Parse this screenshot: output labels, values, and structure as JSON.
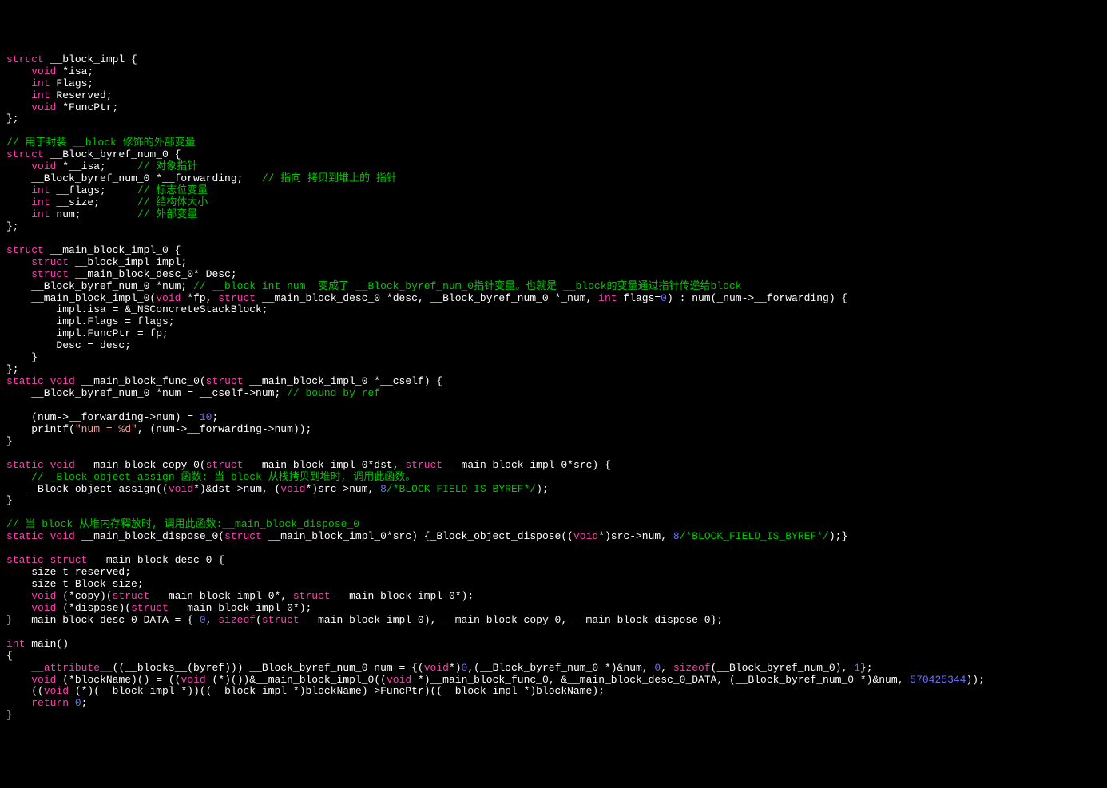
{
  "code": {
    "lines": [
      [
        [
          "kw",
          "struct"
        ],
        [
          "id",
          " __block_impl {"
        ]
      ],
      [
        [
          "id",
          "    "
        ],
        [
          "kw",
          "void"
        ],
        [
          "id",
          " *isa;"
        ]
      ],
      [
        [
          "id",
          "    "
        ],
        [
          "kw",
          "int"
        ],
        [
          "id",
          " Flags;"
        ]
      ],
      [
        [
          "id",
          "    "
        ],
        [
          "kw",
          "int"
        ],
        [
          "id",
          " Reserved;"
        ]
      ],
      [
        [
          "id",
          "    "
        ],
        [
          "kw",
          "void"
        ],
        [
          "id",
          " *FuncPtr;"
        ]
      ],
      [
        [
          "id",
          "};"
        ]
      ],
      [],
      [
        [
          "cm",
          "// 用于封装 __block 修饰的外部变量"
        ]
      ],
      [
        [
          "kw",
          "struct"
        ],
        [
          "id",
          " __Block_byref_num_0 {"
        ]
      ],
      [
        [
          "id",
          "    "
        ],
        [
          "kw",
          "void"
        ],
        [
          "id",
          " *__isa;     "
        ],
        [
          "cm",
          "// 对象指针"
        ]
      ],
      [
        [
          "id",
          "    __Block_byref_num_0 *__forwarding;   "
        ],
        [
          "cm",
          "// 指向 拷贝到堆上的 指针"
        ]
      ],
      [
        [
          "id",
          "    "
        ],
        [
          "kw",
          "int"
        ],
        [
          "id",
          " __flags;     "
        ],
        [
          "cm",
          "// 标志位变量"
        ]
      ],
      [
        [
          "id",
          "    "
        ],
        [
          "kw",
          "int"
        ],
        [
          "id",
          " __size;      "
        ],
        [
          "cm",
          "// 结构体大小"
        ]
      ],
      [
        [
          "id",
          "    "
        ],
        [
          "kw",
          "int"
        ],
        [
          "id",
          " num;         "
        ],
        [
          "cm",
          "// 外部变量"
        ]
      ],
      [
        [
          "id",
          "};"
        ]
      ],
      [],
      [
        [
          "kw",
          "struct"
        ],
        [
          "id",
          " __main_block_impl_0 {"
        ]
      ],
      [
        [
          "id",
          "    "
        ],
        [
          "kw",
          "struct"
        ],
        [
          "id",
          " __block_impl impl;"
        ]
      ],
      [
        [
          "id",
          "    "
        ],
        [
          "kw",
          "struct"
        ],
        [
          "id",
          " __main_block_desc_0* Desc;"
        ]
      ],
      [
        [
          "id",
          "    __Block_byref_num_0 *num; "
        ],
        [
          "cm",
          "// __block int num  变成了 __Block_byref_num_0指针变量。也就是 __block的变量通过指针传递给block"
        ]
      ],
      [
        [
          "id",
          "    __main_block_impl_0("
        ],
        [
          "kw",
          "void"
        ],
        [
          "id",
          " *fp, "
        ],
        [
          "kw",
          "struct"
        ],
        [
          "id",
          " __main_block_desc_0 *desc, __Block_byref_num_0 *_num, "
        ],
        [
          "kw",
          "int"
        ],
        [
          "id",
          " flags="
        ],
        [
          "num",
          "0"
        ],
        [
          "id",
          ") : num(_num->__forwarding) {"
        ]
      ],
      [
        [
          "id",
          "        impl.isa = &_NSConcreteStackBlock;"
        ]
      ],
      [
        [
          "id",
          "        impl.Flags = flags;"
        ]
      ],
      [
        [
          "id",
          "        impl.FuncPtr = fp;"
        ]
      ],
      [
        [
          "id",
          "        Desc = desc;"
        ]
      ],
      [
        [
          "id",
          "    }"
        ]
      ],
      [
        [
          "id",
          "};"
        ]
      ],
      [
        [
          "kw",
          "static"
        ],
        [
          "id",
          " "
        ],
        [
          "kw",
          "void"
        ],
        [
          "id",
          " __main_block_func_0("
        ],
        [
          "kw",
          "struct"
        ],
        [
          "id",
          " __main_block_impl_0 *__cself) {"
        ]
      ],
      [
        [
          "id",
          "    __Block_byref_num_0 *num = __cself->num; "
        ],
        [
          "cm",
          "// bound by ref"
        ]
      ],
      [],
      [
        [
          "id",
          "    (num->__forwarding->num) = "
        ],
        [
          "num",
          "10"
        ],
        [
          "id",
          ";"
        ]
      ],
      [
        [
          "id",
          "    printf("
        ],
        [
          "str",
          "\"num = %d\""
        ],
        [
          "id",
          ", (num->__forwarding->num));"
        ]
      ],
      [
        [
          "id",
          "}"
        ]
      ],
      [],
      [
        [
          "kw",
          "static"
        ],
        [
          "id",
          " "
        ],
        [
          "kw",
          "void"
        ],
        [
          "id",
          " __main_block_copy_0("
        ],
        [
          "kw",
          "struct"
        ],
        [
          "id",
          " __main_block_impl_0*dst, "
        ],
        [
          "kw",
          "struct"
        ],
        [
          "id",
          " __main_block_impl_0*src) {"
        ]
      ],
      [
        [
          "id",
          "    "
        ],
        [
          "cm",
          "// _Block_object_assign 函数: 当 block 从栈拷贝到堆时, 调用此函数。"
        ]
      ],
      [
        [
          "id",
          "    _Block_object_assign(("
        ],
        [
          "kw",
          "void"
        ],
        [
          "id",
          "*)&dst->num, ("
        ],
        [
          "kw",
          "void"
        ],
        [
          "id",
          "*)src->num, "
        ],
        [
          "num",
          "8"
        ],
        [
          "cm",
          "/*BLOCK_FIELD_IS_BYREF*/"
        ],
        [
          "id",
          ");"
        ]
      ],
      [
        [
          "id",
          "}"
        ]
      ],
      [],
      [
        [
          "cm",
          "// 当 block 从堆内存释放时, 调用此函数:__main_block_dispose_0"
        ]
      ],
      [
        [
          "kw",
          "static"
        ],
        [
          "id",
          " "
        ],
        [
          "kw",
          "void"
        ],
        [
          "id",
          " __main_block_dispose_0("
        ],
        [
          "kw",
          "struct"
        ],
        [
          "id",
          " __main_block_impl_0*src) {_Block_object_dispose(("
        ],
        [
          "kw",
          "void"
        ],
        [
          "id",
          "*)src->num, "
        ],
        [
          "num",
          "8"
        ],
        [
          "cm",
          "/*BLOCK_FIELD_IS_BYREF*/"
        ],
        [
          "id",
          ");}"
        ]
      ],
      [],
      [
        [
          "kw",
          "static"
        ],
        [
          "id",
          " "
        ],
        [
          "kw",
          "struct"
        ],
        [
          "id",
          " __main_block_desc_0 {"
        ]
      ],
      [
        [
          "id",
          "    size_t reserved;"
        ]
      ],
      [
        [
          "id",
          "    size_t Block_size;"
        ]
      ],
      [
        [
          "id",
          "    "
        ],
        [
          "kw",
          "void"
        ],
        [
          "id",
          " (*copy)("
        ],
        [
          "kw",
          "struct"
        ],
        [
          "id",
          " __main_block_impl_0*, "
        ],
        [
          "kw",
          "struct"
        ],
        [
          "id",
          " __main_block_impl_0*);"
        ]
      ],
      [
        [
          "id",
          "    "
        ],
        [
          "kw",
          "void"
        ],
        [
          "id",
          " (*dispose)("
        ],
        [
          "kw",
          "struct"
        ],
        [
          "id",
          " __main_block_impl_0*);"
        ]
      ],
      [
        [
          "id",
          "} __main_block_desc_0_DATA = { "
        ],
        [
          "num",
          "0"
        ],
        [
          "id",
          ", "
        ],
        [
          "kw",
          "sizeof"
        ],
        [
          "id",
          "("
        ],
        [
          "kw",
          "struct"
        ],
        [
          "id",
          " __main_block_impl_0), __main_block_copy_0, __main_block_dispose_0};"
        ]
      ],
      [],
      [
        [
          "kw",
          "int"
        ],
        [
          "id",
          " main()"
        ]
      ],
      [
        [
          "id",
          "{"
        ]
      ],
      [
        [
          "id",
          "    "
        ],
        [
          "kw",
          "__attribute__"
        ],
        [
          "id",
          "((__blocks__(byref))) __Block_byref_num_0 num = {("
        ],
        [
          "kw",
          "void"
        ],
        [
          "id",
          "*)"
        ],
        [
          "num",
          "0"
        ],
        [
          "id",
          ",(__Block_byref_num_0 *)&num, "
        ],
        [
          "num",
          "0"
        ],
        [
          "id",
          ", "
        ],
        [
          "kw",
          "sizeof"
        ],
        [
          "id",
          "(__Block_byref_num_0), "
        ],
        [
          "num",
          "1"
        ],
        [
          "id",
          "};"
        ]
      ],
      [
        [
          "id",
          "    "
        ],
        [
          "kw",
          "void"
        ],
        [
          "id",
          " (*blockName)() = (("
        ],
        [
          "kw",
          "void"
        ],
        [
          "id",
          " (*)())&__main_block_impl_0(("
        ],
        [
          "kw",
          "void"
        ],
        [
          "id",
          " *)__main_block_func_0, &__main_block_desc_0_DATA, (__Block_byref_num_0 *)&num, "
        ],
        [
          "num",
          "570425344"
        ],
        [
          "id",
          "));"
        ]
      ],
      [
        [
          "id",
          "    (("
        ],
        [
          "kw",
          "void"
        ],
        [
          "id",
          " (*)(__block_impl *))((__block_impl *)blockName)->FuncPtr)((__block_impl *)blockName);"
        ]
      ],
      [
        [
          "id",
          "    "
        ],
        [
          "kw",
          "return"
        ],
        [
          "id",
          " "
        ],
        [
          "num",
          "0"
        ],
        [
          "id",
          ";"
        ]
      ],
      [
        [
          "id",
          "}"
        ]
      ]
    ]
  },
  "colors": {
    "background": "#000000",
    "keyword": "#ff3db2",
    "comment": "#00c800",
    "string": "#ff9a9a",
    "number": "#6c70ff",
    "identifier": "#ffffff"
  }
}
